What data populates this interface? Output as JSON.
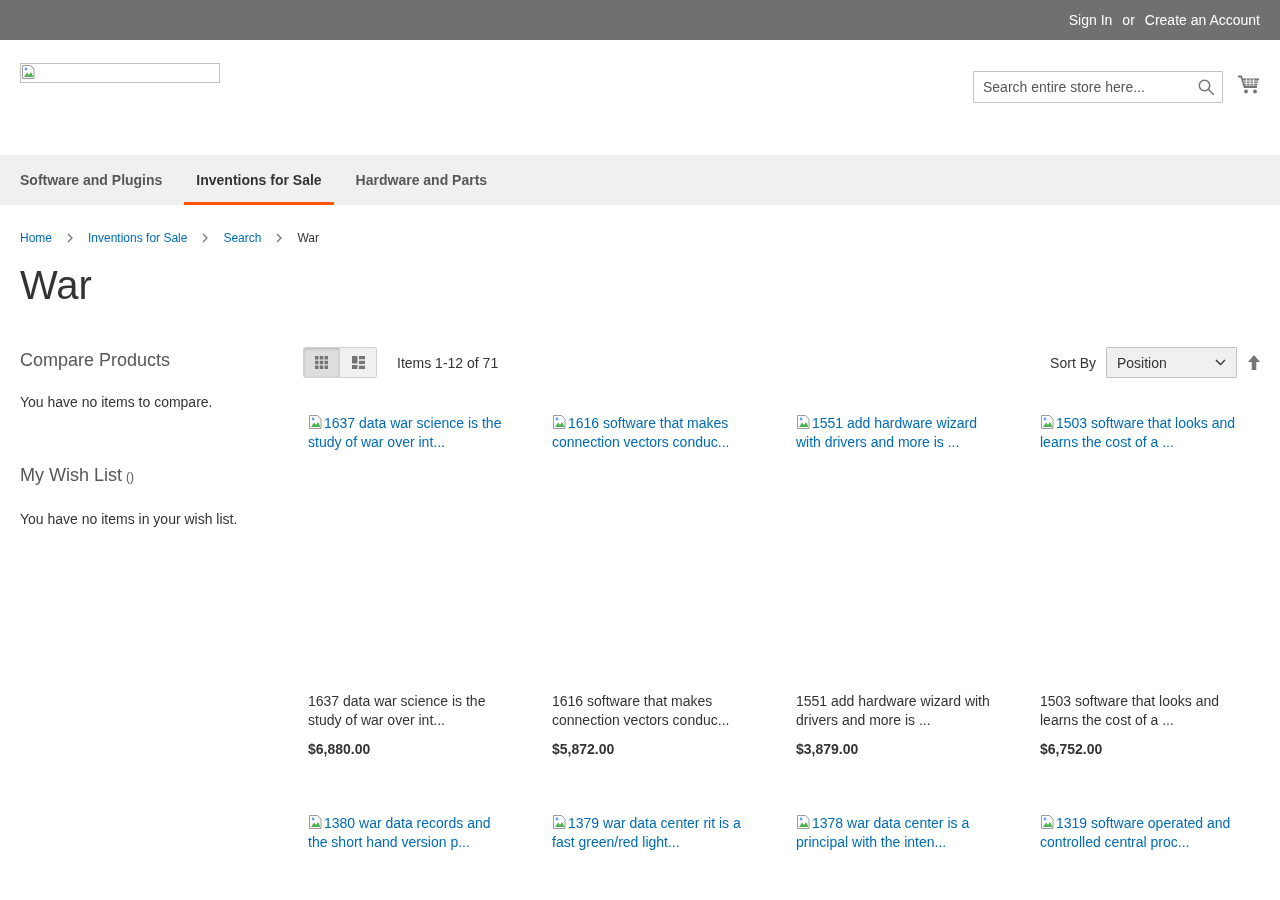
{
  "top_bar": {
    "sign_in": "Sign In",
    "separator": "or",
    "create_account": "Create an Account"
  },
  "header": {
    "search": {
      "placeholder": "Search entire store here..."
    }
  },
  "nav": [
    {
      "label": "Software and Plugins",
      "selected": false
    },
    {
      "label": "Inventions for Sale",
      "selected": true
    },
    {
      "label": "Hardware and Parts",
      "selected": false
    }
  ],
  "breadcrumbs": [
    {
      "label": "Home",
      "current": false
    },
    {
      "label": "Inventions for Sale",
      "current": false
    },
    {
      "label": "Search",
      "current": false
    },
    {
      "label": "War",
      "current": true
    }
  ],
  "page_title": "War",
  "sidebar": {
    "compare": {
      "title": "Compare Products",
      "message": "You have no items to compare."
    },
    "wishlist": {
      "title": "My Wish List",
      "counter": "()",
      "message": "You have no items in your wish list."
    }
  },
  "toolbar": {
    "view_modes": [
      {
        "kind": "grid",
        "selected": true
      },
      {
        "kind": "list",
        "selected": false
      }
    ],
    "amount": "Items 1-12 of 71",
    "sort_label": "Sort By",
    "sort_value": "Position"
  },
  "products": [
    {
      "image_alt": "1637 data war science is the study of war over int...",
      "name": "1637 data war science is the study of war over int...",
      "price": "$6,880.00"
    },
    {
      "image_alt": "1616 software that makes connection vectors conduc...",
      "name": "1616 software that makes connection vectors conduc...",
      "price": "$5,872.00"
    },
    {
      "image_alt": "1551 add hardware wizard with drivers and more is ...",
      "name": "1551 add hardware wizard with drivers and more is ...",
      "price": "$3,879.00"
    },
    {
      "image_alt": "1503 software that looks and learns the cost of a ...",
      "name": "1503 software that looks and learns the cost of a ...",
      "price": "$6,752.00"
    },
    {
      "image_alt": "1380 war data records and the short hand version p..."
    },
    {
      "image_alt": "1379 war data center rit is a fast green/red light..."
    },
    {
      "image_alt": "1378 war data center is a principal with the inten..."
    },
    {
      "image_alt": "1319 software operated and controlled central proc..."
    }
  ]
}
